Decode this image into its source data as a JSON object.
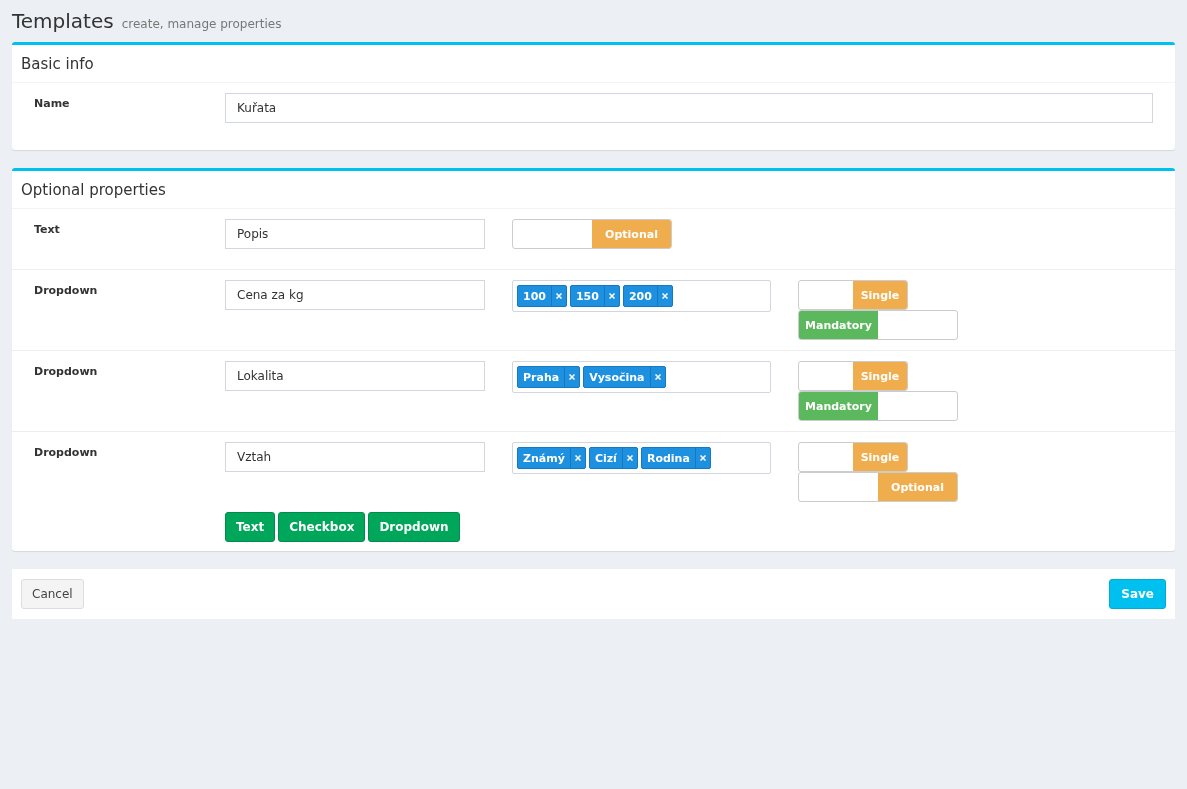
{
  "header": {
    "title": "Templates",
    "subtitle": "create, manage properties"
  },
  "basic_info": {
    "title": "Basic info",
    "name_label": "Name",
    "name_value": "Kuřata"
  },
  "optional_properties": {
    "title": "Optional properties",
    "rows": [
      {
        "kind": "text",
        "label": "Text",
        "value": "Popis",
        "toggles": [
          {
            "label": "Optional",
            "on": false,
            "kind": "wide"
          }
        ]
      },
      {
        "kind": "dropdown",
        "label": "Dropdown",
        "value": "Cena za kg",
        "tags": [
          "100",
          "150",
          "200"
        ],
        "toggles": [
          {
            "label": "Single",
            "on": false,
            "kind": "small"
          },
          {
            "label": "Mandatory",
            "on": true,
            "kind": "wide"
          }
        ]
      },
      {
        "kind": "dropdown",
        "label": "Dropdown",
        "value": "Lokalita",
        "tags": [
          "Praha",
          "Vysočina"
        ],
        "toggles": [
          {
            "label": "Single",
            "on": false,
            "kind": "small"
          },
          {
            "label": "Mandatory",
            "on": true,
            "kind": "wide"
          }
        ]
      },
      {
        "kind": "dropdown",
        "label": "Dropdown",
        "value": "Vztah",
        "tags": [
          "Známý",
          "Cizí",
          "Rodina"
        ],
        "toggles": [
          {
            "label": "Single",
            "on": false,
            "kind": "small"
          },
          {
            "label": "Optional",
            "on": false,
            "kind": "wide"
          }
        ]
      }
    ],
    "add_buttons": [
      "Text",
      "Checkbox",
      "Dropdown"
    ]
  },
  "footer": {
    "cancel": "Cancel",
    "save": "Save"
  }
}
